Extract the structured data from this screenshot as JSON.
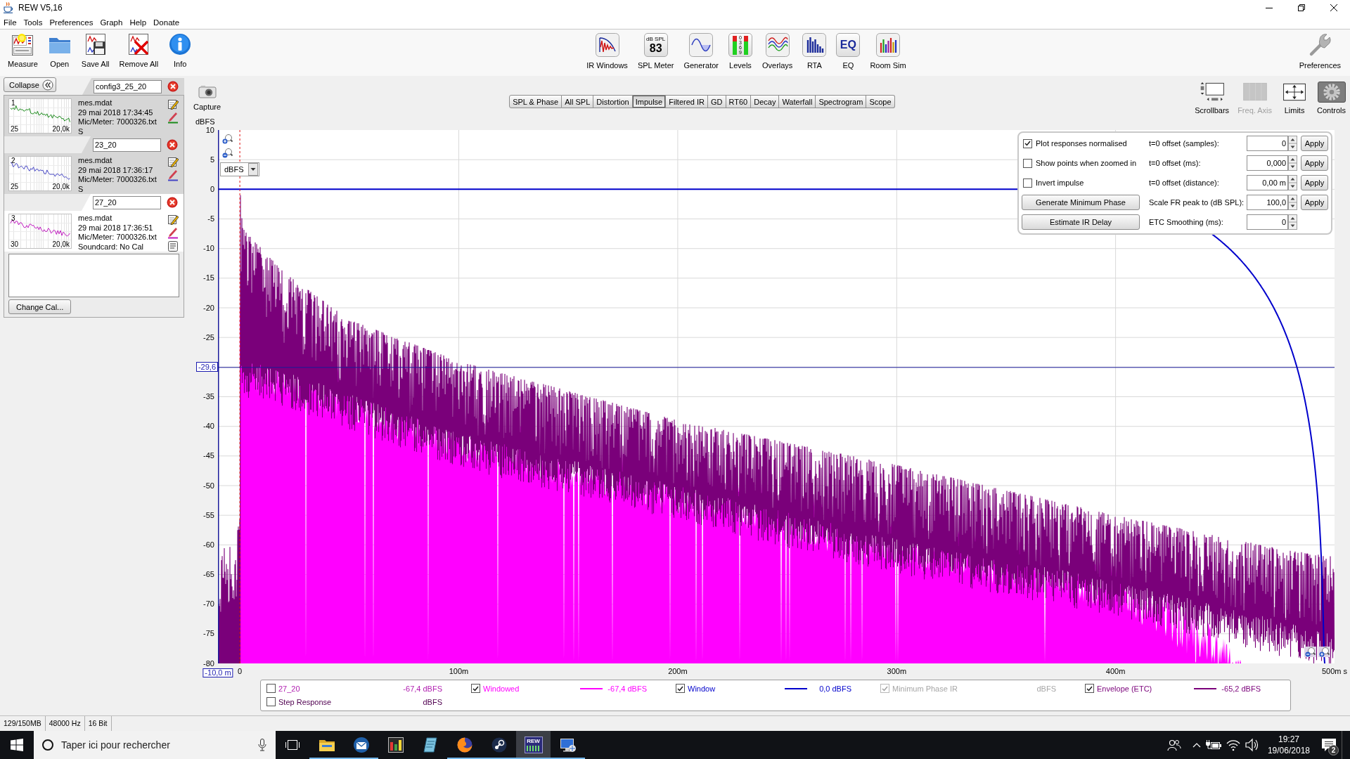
{
  "window": {
    "title": "REW V5,16"
  },
  "menu": [
    "File",
    "Tools",
    "Preferences",
    "Graph",
    "Help",
    "Donate"
  ],
  "toolbar": {
    "left": [
      {
        "label": "Measure",
        "kind": "measure"
      },
      {
        "label": "Open",
        "kind": "open"
      },
      {
        "label": "Save All",
        "kind": "save_all"
      },
      {
        "label": "Remove All",
        "kind": "remove_all"
      },
      {
        "label": "Info",
        "kind": "info"
      }
    ],
    "center": [
      {
        "label": "IR Windows",
        "kind": "ir_windows"
      },
      {
        "label": "SPL Meter",
        "kind": "spl_meter",
        "icon_text": [
          "dB SPL",
          "83"
        ]
      },
      {
        "label": "Generator",
        "kind": "generator"
      },
      {
        "label": "Levels",
        "kind": "levels",
        "icon_text": [
          "0",
          "3",
          "6",
          "9"
        ]
      },
      {
        "label": "Overlays",
        "kind": "overlays"
      },
      {
        "label": "RTA",
        "kind": "rta"
      },
      {
        "label": "EQ",
        "kind": "eq",
        "icon_text": [
          "EQ"
        ]
      },
      {
        "label": "Room Sim",
        "kind": "room_sim"
      }
    ],
    "right": [
      {
        "label": "Preferences",
        "kind": "preferences"
      }
    ]
  },
  "sidebar": {
    "collapse": "Collapse",
    "measurements": [
      {
        "number": "1",
        "name": "config3_25_20",
        "file": "mes.mdat",
        "date": "29 mai 2018 17:34:45",
        "mic": "Mic/Meter: 7000326.txt",
        "soundcard": "S",
        "low": "25",
        "high": "20,0k",
        "color": "#1a8a1a",
        "selected": false
      },
      {
        "number": "2",
        "name": "23_20",
        "file": "mes.mdat",
        "date": "29 mai 2018 17:36:17",
        "mic": "Mic/Meter: 7000326.txt",
        "soundcard": "S",
        "low": "25",
        "high": "20,0k",
        "color": "#4444c4",
        "selected": false
      },
      {
        "number": "3",
        "name": "27_20",
        "file": "mes.mdat",
        "date": "29 mai 2018 17:36:51",
        "mic": "Mic/Meter: 7000326.txt",
        "soundcard": "Soundcard: No Cal",
        "low": "30",
        "high": "20,0k",
        "color": "#c018c0",
        "selected": true
      }
    ],
    "change_cal": "Change Cal..."
  },
  "graph": {
    "capture": "Capture",
    "tabs": [
      {
        "label": "SPL & Phase",
        "selected": false
      },
      {
        "label": "All SPL",
        "selected": false
      },
      {
        "label": "Distortion",
        "selected": false
      },
      {
        "label": "Impulse",
        "selected": true
      },
      {
        "label": "Filtered IR",
        "selected": false
      },
      {
        "label": "GD",
        "selected": false
      },
      {
        "label": "RT60",
        "selected": false
      },
      {
        "label": "Decay",
        "selected": false
      },
      {
        "label": "Waterfall",
        "selected": false
      },
      {
        "label": "Spectrogram",
        "selected": false
      },
      {
        "label": "Scope",
        "selected": false
      }
    ],
    "tools": [
      {
        "label": "Scrollbars",
        "kind": "scrollbars",
        "selected": false,
        "disabled": false
      },
      {
        "label": "Freq. Axis",
        "kind": "freq_axis",
        "selected": false,
        "disabled": true
      },
      {
        "label": "Limits",
        "kind": "limits",
        "selected": false,
        "disabled": false
      },
      {
        "label": "Controls",
        "kind": "controls",
        "selected": true,
        "disabled": false
      }
    ],
    "y_axis": {
      "unit": "dBFS",
      "ticks": [
        {
          "label": "10",
          "kind": "tick"
        },
        {
          "label": "5",
          "kind": "tick"
        },
        {
          "label": "0",
          "kind": "tick"
        },
        {
          "label": "-5",
          "kind": "tick"
        },
        {
          "label": "-10",
          "kind": "tick"
        },
        {
          "label": "-15",
          "kind": "tick"
        },
        {
          "label": "-20",
          "kind": "tick"
        },
        {
          "label": "-25",
          "kind": "tick"
        },
        {
          "label": "-29,6",
          "kind": "cursor"
        },
        {
          "label": "-35",
          "kind": "tick"
        },
        {
          "label": "-40",
          "kind": "tick"
        },
        {
          "label": "-45",
          "kind": "tick"
        },
        {
          "label": "-50",
          "kind": "tick"
        },
        {
          "label": "-55",
          "kind": "tick"
        },
        {
          "label": "-60",
          "kind": "tick"
        },
        {
          "label": "-65",
          "kind": "tick"
        },
        {
          "label": "-70",
          "kind": "tick"
        },
        {
          "label": "-75",
          "kind": "tick"
        },
        {
          "label": "-80",
          "kind": "tick"
        }
      ]
    },
    "x_axis": {
      "ticks": [
        {
          "label": "-10,0 m",
          "kind": "cursor"
        },
        {
          "label": "0",
          "kind": "tick"
        },
        {
          "label": "100m",
          "kind": "tick"
        },
        {
          "label": "200m",
          "kind": "tick"
        },
        {
          "label": "300m",
          "kind": "tick"
        },
        {
          "label": "400m",
          "kind": "tick"
        },
        {
          "label": "500m s",
          "kind": "tick"
        }
      ]
    },
    "unit_selector": {
      "value": "dBFS"
    },
    "controls_panel": {
      "options": [
        {
          "label": "Plot responses normalised",
          "checked": true
        },
        {
          "label": "Show points when zoomed in",
          "checked": false
        },
        {
          "label": "Invert impulse",
          "checked": false
        }
      ],
      "buttons": [
        "Generate Minimum Phase",
        "Estimate IR Delay"
      ],
      "fields": [
        {
          "label": "t=0 offset (samples):",
          "value": "0",
          "action": "Apply"
        },
        {
          "label": "t=0 offset (ms):",
          "value": "0,000",
          "action": "Apply"
        },
        {
          "label": "t=0 offset (distance):",
          "value": "0,00 m",
          "action": "Apply"
        },
        {
          "label": "Scale FR peak to (dB SPL):",
          "value": "100,0",
          "action": "Apply"
        },
        {
          "label": "ETC Smoothing (ms):",
          "value": "0"
        }
      ]
    },
    "legend": [
      {
        "label": "27_20",
        "kind": "measurement",
        "checked": false,
        "disabled": false,
        "value": "-67,4 dBFS",
        "color": "#b020b0"
      },
      {
        "label": "Windowed",
        "kind": "windowed",
        "checked": true,
        "disabled": false,
        "value": "-67,4 dBFS",
        "color": "#ff00ff"
      },
      {
        "label": "Window",
        "kind": "window",
        "checked": true,
        "disabled": false,
        "value": "0,0 dBFS",
        "color": "#0000cc"
      },
      {
        "label": "Minimum Phase IR",
        "kind": "min_phase",
        "checked": true,
        "disabled": true,
        "value": "dBFS"
      },
      {
        "label": "Envelope (ETC)",
        "kind": "envelope",
        "checked": true,
        "disabled": false,
        "value": "-65,2 dBFS",
        "color": "#7a007a"
      },
      {
        "label": "Step Response",
        "kind": "step",
        "checked": false,
        "disabled": false,
        "value": "dBFS",
        "color": "#500050"
      }
    ]
  },
  "status_bar": [
    "129/150MB",
    "48000 Hz",
    "16 Bit"
  ],
  "taskbar": {
    "search": {
      "placeholder": "Taper ici pour rechercher"
    },
    "apps": [
      {
        "kind": "folder",
        "running": true,
        "selected": false
      },
      {
        "kind": "mail",
        "running": true,
        "selected": false
      },
      {
        "kind": "studio",
        "running": false,
        "selected": false
      },
      {
        "kind": "notes",
        "running": false,
        "selected": false
      },
      {
        "kind": "browser",
        "running": true,
        "selected": false
      },
      {
        "kind": "game",
        "running": true,
        "selected": false
      },
      {
        "kind": "rew",
        "label": "REW",
        "running": true,
        "selected": true
      },
      {
        "kind": "remote",
        "running": true,
        "selected": false
      }
    ],
    "time": "19:27",
    "date": "19/06/2018",
    "notifications": "2"
  }
}
